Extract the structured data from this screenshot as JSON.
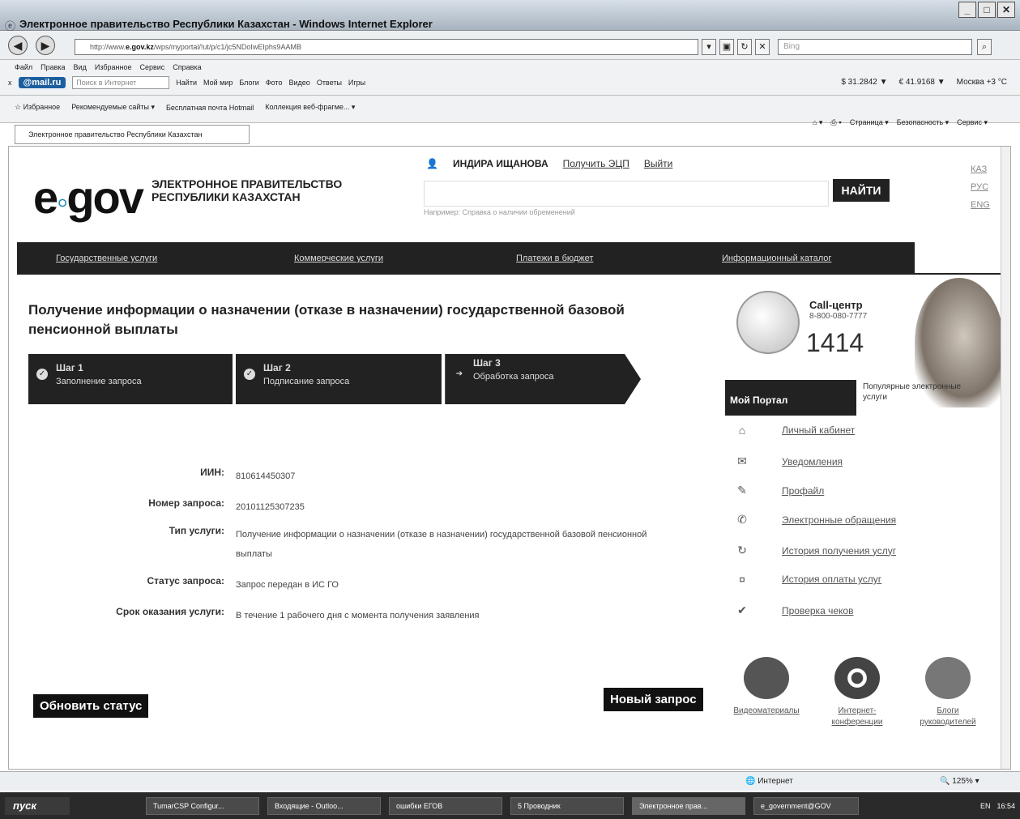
{
  "browser": {
    "title": "Электронное правительство Республики Казахстан - Windows Internet Explorer",
    "url_domain": "e.gov.kz",
    "url_prefix": "http://www.",
    "url_rest": "/wps/myportal/!ut/p/c1/jc5NDoIwEIphs9AAMB",
    "bing_placeholder": "Bing",
    "menu": [
      "Файл",
      "Правка",
      "Вид",
      "Избранное",
      "Сервис",
      "Справка"
    ],
    "mail": {
      "logo": "@mail.ru",
      "search_placeholder": "Поиск в Интернет",
      "find": "Найти",
      "links": [
        "Мой мир",
        "Блоги",
        "Фото",
        "Видео",
        "Ответы",
        "Игры"
      ]
    },
    "rates": {
      "usd": "$ 31.2842 ▼",
      "eur": "€ 41.9168 ▼",
      "weather": "Москва +3 °C"
    },
    "favorites": {
      "label": "Избранное",
      "items": [
        "Рекомендуемые сайты ▾",
        "Бесплатная почта Hotmail",
        "Коллекция веб-фрагме... ▾"
      ]
    },
    "tab_title": "Электронное правительство Республики Казахстан",
    "cmd": [
      "Страница ▾",
      "Безопасность ▾",
      "Сервис ▾"
    ],
    "status": {
      "zone": "Интернет",
      "zoom": "125%"
    }
  },
  "site": {
    "logo": "e.gov",
    "logo_line1": "ЭЛЕКТРОННОЕ ПРАВИТЕЛЬСТВО",
    "logo_line2": "РЕСПУБЛИКИ КАЗАХСТАН",
    "user_name": "ИНДИРА ИЩАНОВА",
    "get_ecp": "Получить ЭЦП",
    "logout": "Выйти",
    "search_button": "НАЙТИ",
    "search_hint": "Например: Справка о наличии обременений",
    "langs": [
      "КАЗ",
      "РУС",
      "ENG"
    ],
    "nav": [
      "Государственные услуги",
      "Коммерческие услуги",
      "Платежи в бюджет",
      "Информационный каталог"
    ]
  },
  "main": {
    "title": "Получение информации о назначении (отказе в назначении) государственной базовой пенсионной выплаты",
    "steps": [
      {
        "n": "Шаг 1",
        "d": "Заполнение запроса"
      },
      {
        "n": "Шаг 2",
        "d": "Подписание запроса"
      },
      {
        "n": "Шаг 3",
        "d": "Обработка запроса"
      }
    ],
    "fields": [
      {
        "label": "ИИН:",
        "value": "810614450307"
      },
      {
        "label": "Номер запроса:",
        "value": "20101125307235"
      },
      {
        "label": "Тип услуги:",
        "value": "Получение информации о назначении (отказе в назначении) государственной базовой пенсионной выплаты"
      },
      {
        "label": "Статус запроса:",
        "value": "Запрос передан в ИС ГО"
      },
      {
        "label": "Срок оказания услуги:",
        "value": "В течение 1 рабочего дня с момента получения заявления"
      }
    ],
    "refresh_button": "Обновить статус",
    "new_request_button": "Новый запрос"
  },
  "sidebar": {
    "call_title": "Call-центр",
    "call_phone": "8-800-080-7777",
    "call_short": "1414",
    "tab_my": "Мой Портал",
    "tab_popular": "Популярные электронные услуги",
    "menu": [
      "Личный кабинет",
      "Уведомления",
      "Профайл",
      "Электронные обращения",
      "История получения услуг",
      "История оплаты услуг",
      "Проверка чеков"
    ],
    "tiles": [
      "Видеоматериалы",
      "Интернет-конференции",
      "Блоги руководителей"
    ]
  },
  "taskbar": {
    "start": "пуск",
    "tasks": [
      "TumarCSP Configur...",
      "Входящие - Outloo...",
      "ошибки ЕГОВ",
      "5 Проводник",
      "Электронное прав...",
      "e_government@GOV"
    ],
    "lang": "EN",
    "time": "16:54"
  }
}
